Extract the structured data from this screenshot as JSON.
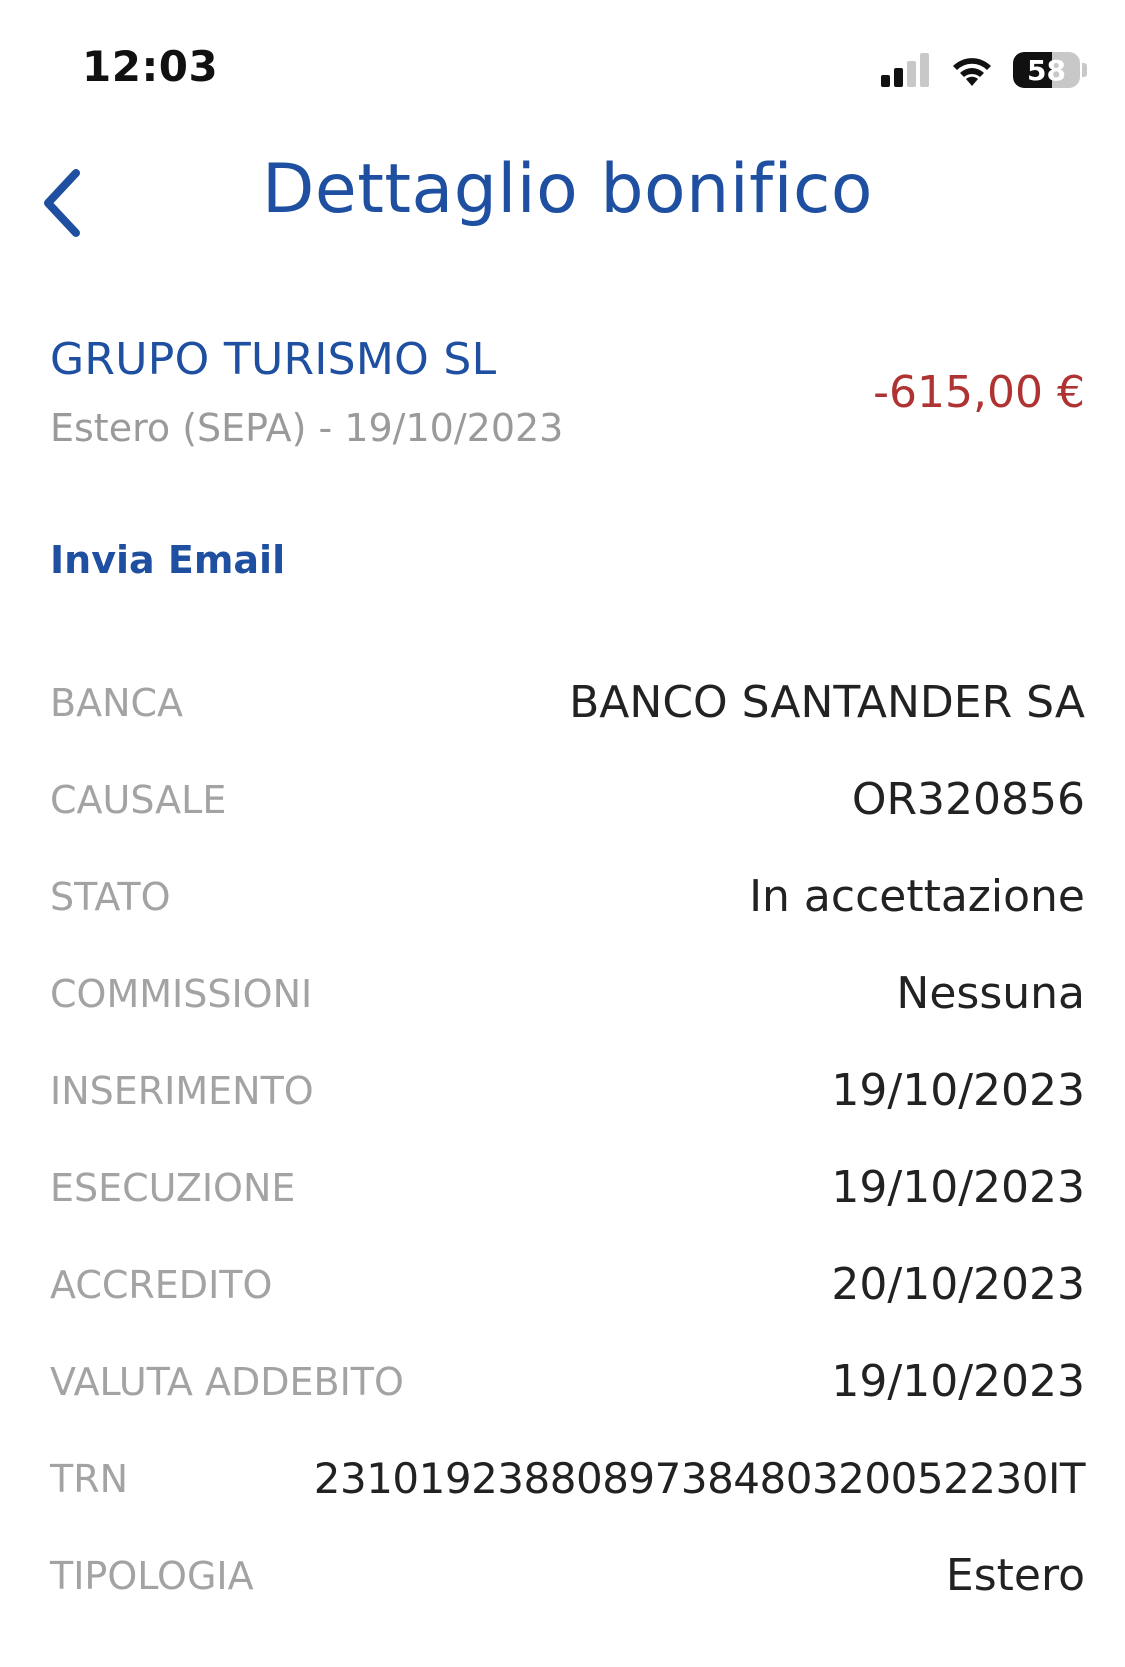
{
  "status_bar": {
    "time": "12:03",
    "battery_level": "58",
    "battery_fraction": 0.58
  },
  "nav": {
    "title": "Dettaglio bonifico",
    "back_icon": "chevron-left-icon"
  },
  "transfer": {
    "beneficiary": "GRUPO TURISMO SL",
    "subtitle": "Estero (SEPA) - 19/10/2023",
    "amount": "-615,00 €",
    "amount_color": "#b03333"
  },
  "actions": {
    "send_email": "Invia Email"
  },
  "details": [
    {
      "label": "BANCA",
      "value": "BANCO SANTANDER SA"
    },
    {
      "label": "CAUSALE",
      "value": "OR320856"
    },
    {
      "label": "STATO",
      "value": "In accettazione"
    },
    {
      "label": "COMMISSIONI",
      "value": "Nessuna"
    },
    {
      "label": "INSERIMENTO",
      "value": "19/10/2023"
    },
    {
      "label": "ESECUZIONE",
      "value": "19/10/2023"
    },
    {
      "label": "ACCREDITO",
      "value": "20/10/2023"
    },
    {
      "label": "VALUTA ADDEBITO",
      "value": "19/10/2023"
    },
    {
      "label": "TRN",
      "value": "2310192388089738480320052230IT"
    },
    {
      "label": "TIPOLOGIA",
      "value": "Estero"
    }
  ],
  "colors": {
    "accent": "#1e4fa0",
    "label_gray": "#a3a3a3",
    "value_dark": "#222222",
    "negative": "#b03333"
  }
}
